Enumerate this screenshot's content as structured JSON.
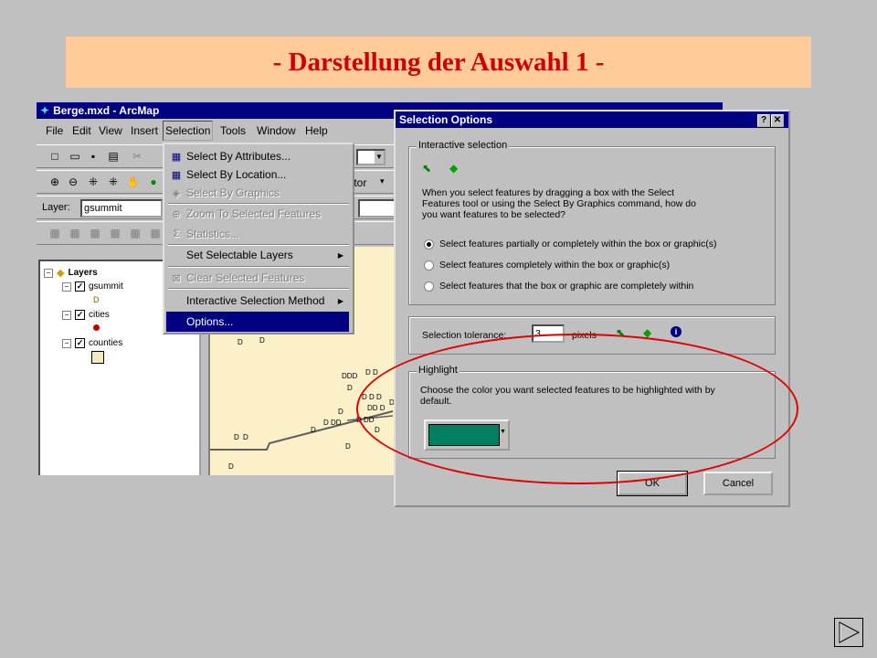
{
  "slide": {
    "title": "- Darstellung der Auswahl 1 -",
    "title_color": "#cc0000",
    "title_bg": "#ffcc99"
  },
  "arcmap": {
    "window_title": "Berge.mxd - ArcMap",
    "menus": [
      "File",
      "Edit",
      "View",
      "Insert",
      "Selection",
      "Tools",
      "Window",
      "Help"
    ],
    "layer_label": "Layer:",
    "layer_value": "gsummit",
    "editor_label": "ditor",
    "toc": {
      "root": "Layers",
      "layers": [
        "gsummit",
        "cities",
        "counties"
      ]
    }
  },
  "selection_menu": {
    "items": [
      {
        "label": "Select By Attributes...",
        "icon": "select-by-attributes-icon",
        "enabled": true
      },
      {
        "label": "Select By Location...",
        "icon": "select-by-location-icon",
        "enabled": true
      },
      {
        "label": "Select By Graphics",
        "icon": "select-by-graphics-icon",
        "enabled": false
      },
      {
        "label": "Zoom To Selected Features",
        "icon": "zoom-selected-icon",
        "enabled": false
      },
      {
        "label": "Statistics...",
        "icon": "sigma-icon",
        "enabled": false
      },
      {
        "label": "Set Selectable Layers",
        "submenu": true,
        "enabled": true
      },
      {
        "label": "Clear Selected Features",
        "icon": "clear-selection-icon",
        "enabled": false
      },
      {
        "label": "Interactive Selection Method",
        "submenu": true,
        "enabled": true
      },
      {
        "label": "Options...",
        "highlighted": true,
        "enabled": true
      }
    ]
  },
  "dialog": {
    "title": "Selection Options",
    "interactive": {
      "legend": "Interactive selection",
      "description": [
        "When you select features by dragging a box with the Select",
        "Features tool or using the Select By Graphics command, how do",
        "you want features to be selected?"
      ],
      "options": [
        "Select features partially or completely within the box or graphic(s)",
        "Select features completely within the box or graphic(s)",
        "Select features that the box or graphic are completely within"
      ],
      "selected_index": 0
    },
    "tolerance": {
      "label": "Selection tolerance:",
      "value": "3",
      "unit": "pixels"
    },
    "highlight": {
      "legend": "Highlight",
      "description": [
        "Choose the color you want selected features to be highlighted with by",
        "default."
      ],
      "color": "#008060"
    },
    "ok_label": "OK",
    "cancel_label": "Cancel"
  },
  "annotation": {
    "ellipse_color": "#e00000"
  }
}
